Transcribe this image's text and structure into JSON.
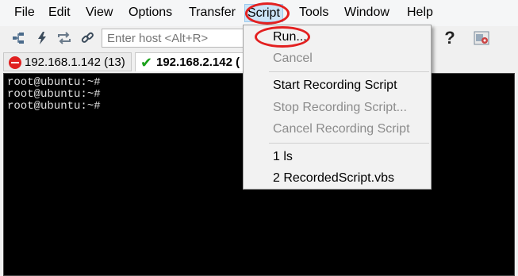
{
  "menubar": {
    "items": [
      "File",
      "Edit",
      "View",
      "Options",
      "Transfer",
      "Script",
      "Tools",
      "Window",
      "Help"
    ]
  },
  "toolbar": {
    "host_placeholder": "Enter host <Alt+R>",
    "icons": [
      "connect-tree-icon",
      "lightning-icon",
      "reconnect-icon",
      "link-icon",
      "help-icon",
      "settings-icon"
    ],
    "help_glyph": "?"
  },
  "tabs": [
    {
      "label": "192.168.1.142 (13)",
      "status": "disconnected",
      "status_color": "#e02020"
    },
    {
      "label": "192.168.2.142 (",
      "status": "connected",
      "status_color": "#1aa01a"
    }
  ],
  "terminal": {
    "lines": [
      "root@ubuntu:~#",
      "root@ubuntu:~#",
      "root@ubuntu:~#"
    ]
  },
  "script_menu": {
    "run": "Run...",
    "cancel": "Cancel",
    "start_recording": "Start Recording Script",
    "stop_recording": "Stop Recording Script...",
    "cancel_recording": "Cancel Recording Script",
    "recent1": "1 ls",
    "recent2": "2 RecordedScript.vbs"
  },
  "annotation_color": "#e32020"
}
